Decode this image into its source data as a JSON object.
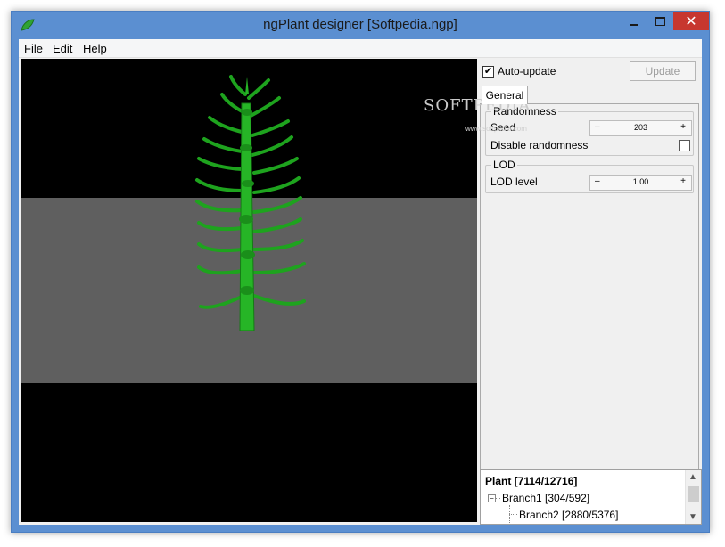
{
  "window": {
    "title": "ngPlant designer [Softpedia.ngp]",
    "close_glyph": "✕"
  },
  "menu": {
    "items": [
      "File",
      "Edit",
      "Help"
    ]
  },
  "panel": {
    "autoupdate_label": "Auto-update",
    "autoupdate_checked": true,
    "check_glyph": "✔",
    "update_button": "Update",
    "tab_general": "General",
    "randomness": {
      "title": "Randomness",
      "seed_label": "Seed",
      "seed_value": "203",
      "disable_label": "Disable randomness"
    },
    "lod": {
      "title": "LOD",
      "level_label": "LOD level",
      "level_value": "1.00"
    },
    "spin_minus": "–",
    "spin_plus": "+"
  },
  "watermark": {
    "text": "SOFTPEDIA",
    "sub": "www.softpedia.com"
  },
  "tree": {
    "root": "Plant [7114/12716]",
    "branch1": "Branch1 [304/592]",
    "branch2": "Branch2 [2880/5376]",
    "expander_glyph": "−"
  },
  "scrollbar": {
    "up_glyph": "▲",
    "down_glyph": "▼"
  },
  "colors": {
    "titlebar": "#5b8fd1",
    "close_button": "#c7372f",
    "viewport_bg": "#000000",
    "ground": "#5f5f5f",
    "plant": "#1fa51f"
  }
}
